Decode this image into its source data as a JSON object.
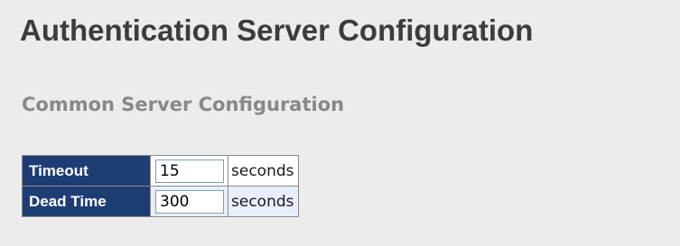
{
  "page": {
    "title": "Authentication Server Configuration"
  },
  "common_server": {
    "heading": "Common Server Configuration",
    "rows": [
      {
        "label": "Timeout",
        "value": "15",
        "unit": "seconds"
      },
      {
        "label": "Dead Time",
        "value": "300",
        "unit": "seconds"
      }
    ]
  },
  "colors": {
    "label_background": "#1f3d75",
    "label_text": "#ffffff",
    "page_background": "#ececec",
    "title_text": "#3c3c3c",
    "section_text": "#888888"
  }
}
